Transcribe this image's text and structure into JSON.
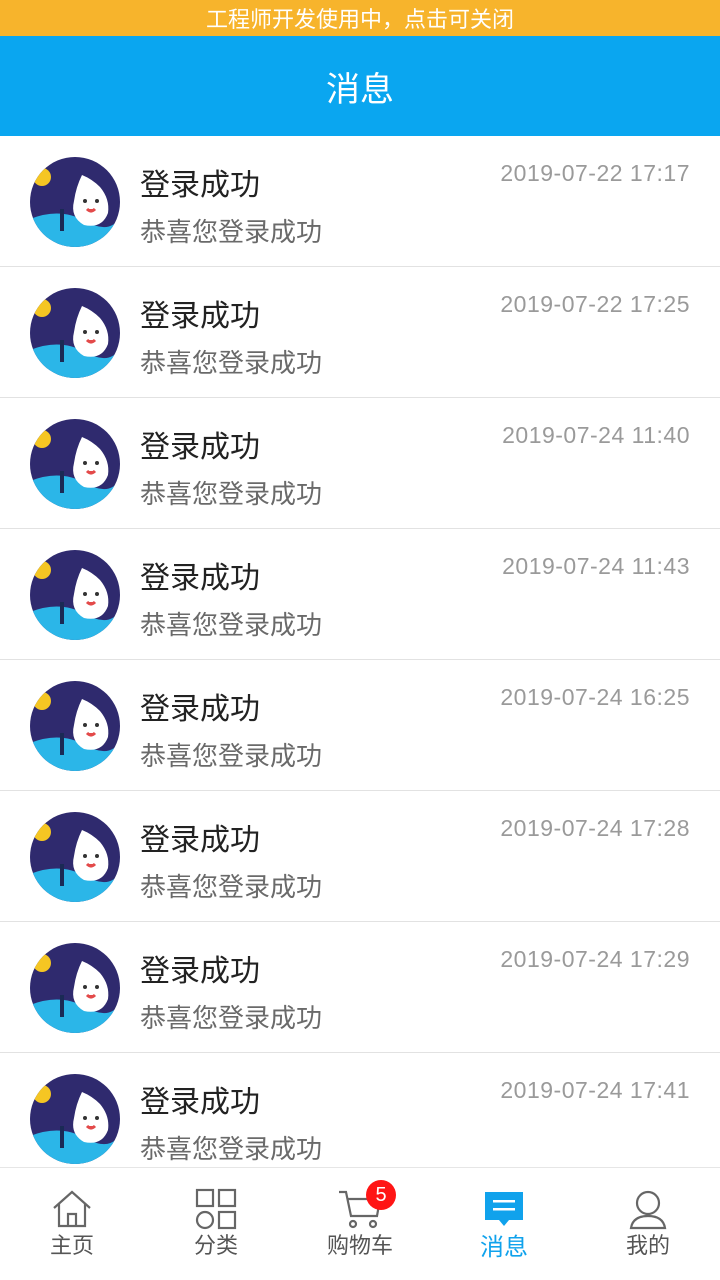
{
  "dev_banner": {
    "text": "工程师开发使用中，点击可关闭"
  },
  "header": {
    "title": "消息"
  },
  "messages": [
    {
      "title": "登录成功",
      "subtitle": "恭喜您登录成功",
      "time": "2019-07-22 17:17"
    },
    {
      "title": "登录成功",
      "subtitle": "恭喜您登录成功",
      "time": "2019-07-22 17:25"
    },
    {
      "title": "登录成功",
      "subtitle": "恭喜您登录成功",
      "time": "2019-07-24 11:40"
    },
    {
      "title": "登录成功",
      "subtitle": "恭喜您登录成功",
      "time": "2019-07-24 11:43"
    },
    {
      "title": "登录成功",
      "subtitle": "恭喜您登录成功",
      "time": "2019-07-24 16:25"
    },
    {
      "title": "登录成功",
      "subtitle": "恭喜您登录成功",
      "time": "2019-07-24 17:28"
    },
    {
      "title": "登录成功",
      "subtitle": "恭喜您登录成功",
      "time": "2019-07-24 17:29"
    },
    {
      "title": "登录成功",
      "subtitle": "恭喜您登录成功",
      "time": "2019-07-24 17:41"
    }
  ],
  "tabbar": {
    "items": [
      {
        "label": "主页",
        "icon": "home-icon",
        "active": false
      },
      {
        "label": "分类",
        "icon": "category-grid-icon",
        "active": false
      },
      {
        "label": "购物车",
        "icon": "cart-icon",
        "active": false,
        "badge": "5"
      },
      {
        "label": "消息",
        "icon": "message-icon",
        "active": true
      },
      {
        "label": "我的",
        "icon": "user-icon",
        "active": false
      }
    ]
  },
  "colors": {
    "banner": "#f7b42c",
    "header": "#0aa6f0",
    "active_tab": "#10a2ec",
    "badge": "#ff1515"
  }
}
